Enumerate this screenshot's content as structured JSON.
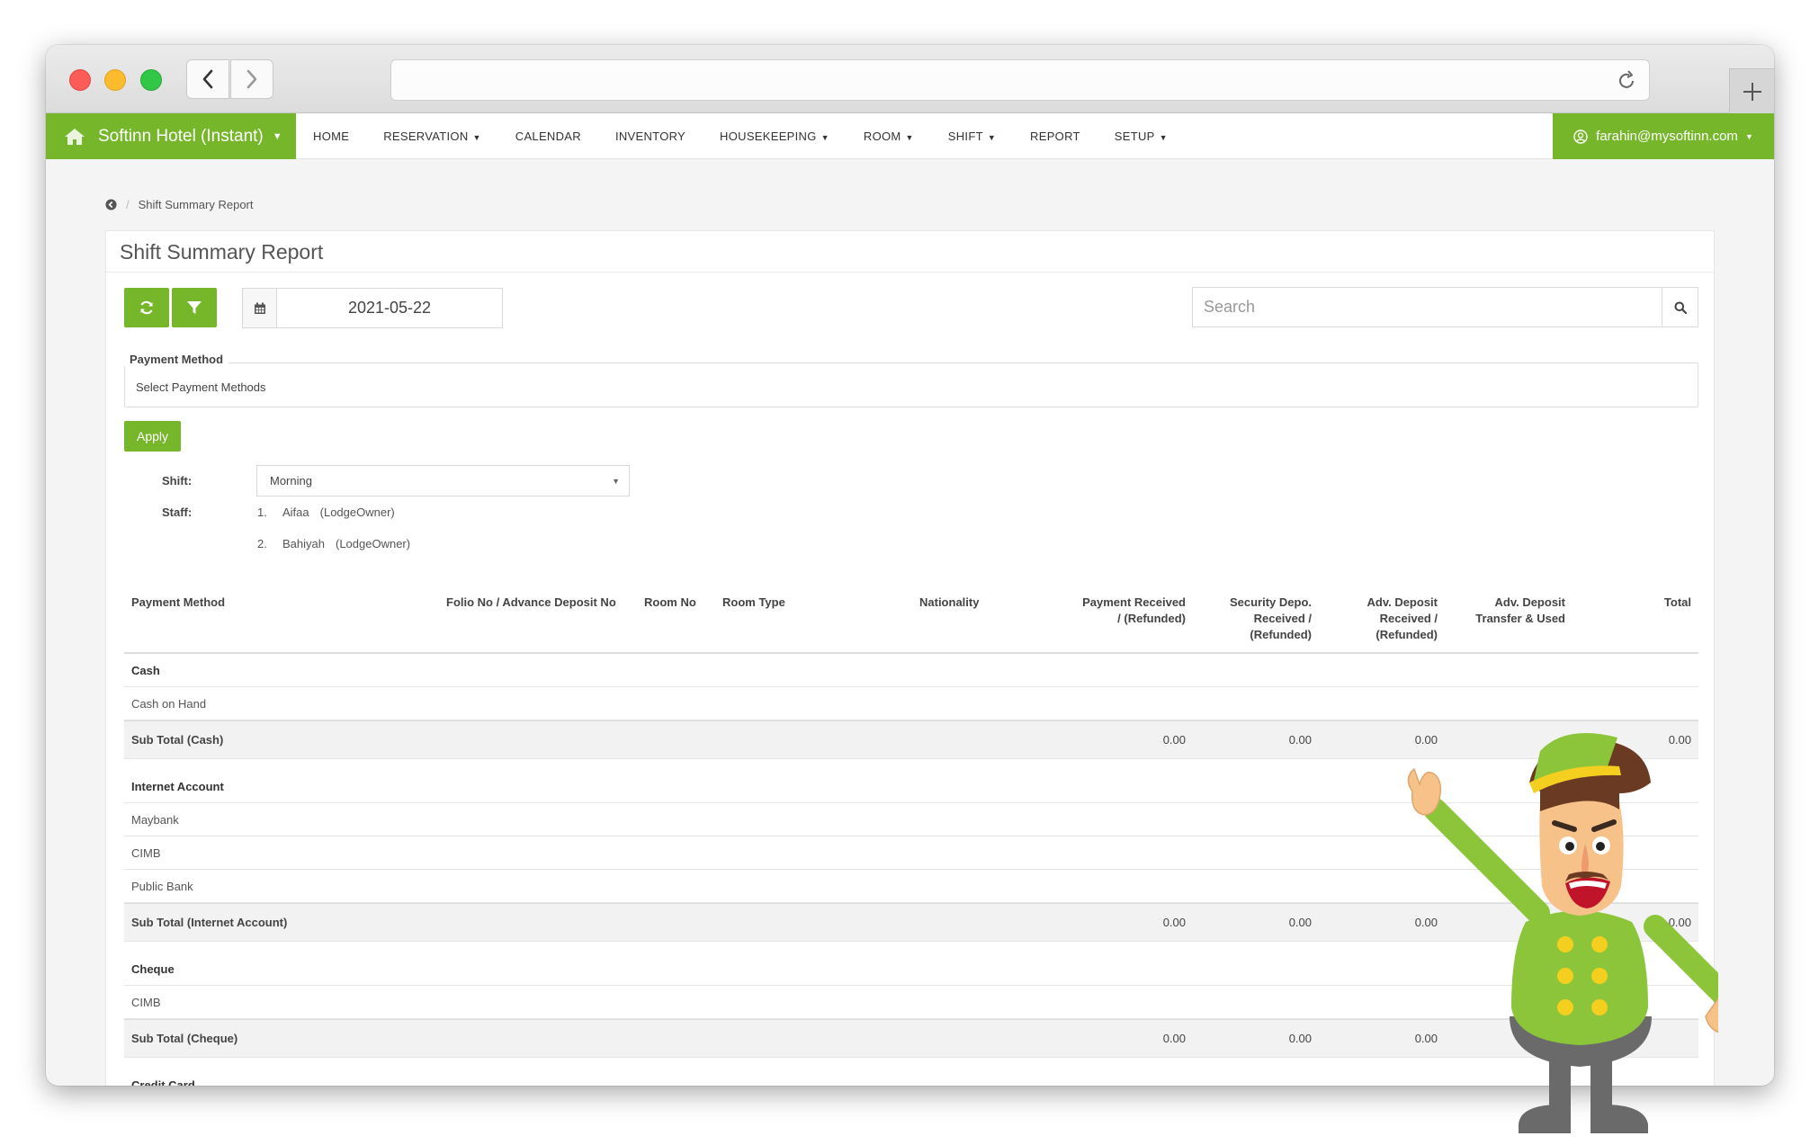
{
  "app": {
    "brand": "Softinn Hotel (Instant)",
    "nav": [
      {
        "label": "HOME",
        "caret": false
      },
      {
        "label": "RESERVATION",
        "caret": true
      },
      {
        "label": "CALENDAR",
        "caret": false
      },
      {
        "label": "INVENTORY",
        "caret": false
      },
      {
        "label": "HOUSEKEEPING",
        "caret": true
      },
      {
        "label": "ROOM",
        "caret": true
      },
      {
        "label": "SHIFT",
        "caret": true
      },
      {
        "label": "REPORT",
        "caret": false
      },
      {
        "label": "SETUP",
        "caret": true
      }
    ],
    "user": "farahin@mysoftinn.com"
  },
  "breadcrumb": {
    "current": "Shift Summary Report"
  },
  "page": {
    "title": "Shift Summary Report",
    "date": "2021-05-22",
    "search_placeholder": "Search",
    "payment_method_legend": "Payment Method",
    "payment_method_placeholder": "Select Payment Methods",
    "apply_label": "Apply",
    "shift_label": "Shift:",
    "shift_value": "Morning",
    "staff_label": "Staff:",
    "staff": [
      {
        "num": "1.",
        "name": "Aifaa",
        "role": "(LodgeOwner)"
      },
      {
        "num": "2.",
        "name": "Bahiyah",
        "role": "(LodgeOwner)"
      }
    ]
  },
  "table": {
    "headers": {
      "payment_method": "Payment Method",
      "folio": "Folio No / Advance Deposit No",
      "room_no": "Room No",
      "room_type": "Room Type",
      "nationality": "Nationality",
      "payment_received": [
        "Payment Received",
        "/ (Refunded)"
      ],
      "security": [
        "Security Depo.",
        "Received /",
        "(Refunded)"
      ],
      "adv_received": [
        "Adv. Deposit",
        "Received /",
        "(Refunded)"
      ],
      "adv_transfer": [
        "Adv. Deposit",
        "Transfer & Used"
      ],
      "total": "Total"
    },
    "groups": [
      {
        "name": "Cash",
        "items": [
          "Cash on Hand"
        ],
        "subtotal": {
          "label": "Sub Total (Cash)",
          "payment": "0.00",
          "security": "0.00",
          "adv": "0.00",
          "total": "0.00"
        }
      },
      {
        "name": "Internet Account",
        "items": [
          "Maybank",
          "CIMB",
          "Public Bank"
        ],
        "subtotal": {
          "label": "Sub Total (Internet Account)",
          "payment": "0.00",
          "security": "0.00",
          "adv": "0.00",
          "total": "0.00"
        }
      },
      {
        "name": "Cheque",
        "items": [
          "CIMB"
        ],
        "subtotal": {
          "label": "Sub Total (Cheque)",
          "payment": "0.00",
          "security": "0.00",
          "adv": "0.00",
          "total": ""
        }
      },
      {
        "name": "Credit Card",
        "items": [],
        "subtotal": null
      }
    ]
  },
  "colors": {
    "accent": "#76b62a"
  }
}
